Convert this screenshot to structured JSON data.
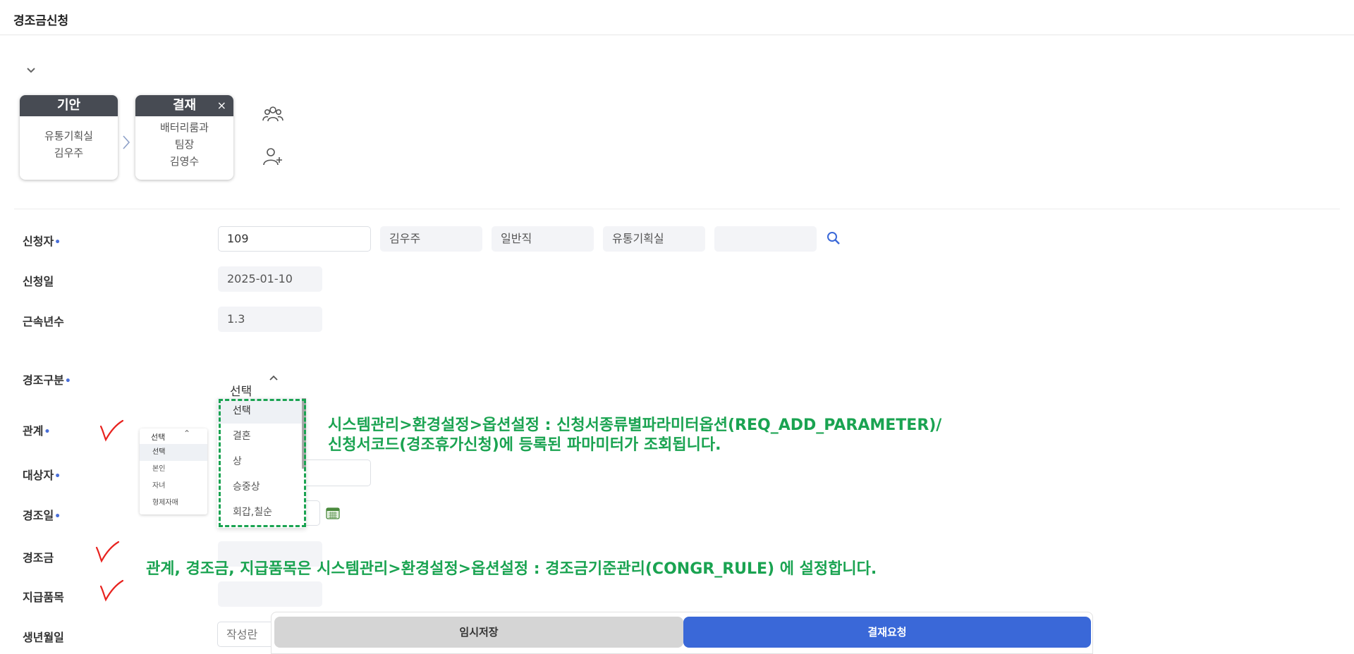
{
  "page": {
    "title": "경조금신청"
  },
  "approval_line": {
    "cards": [
      {
        "head": "기안",
        "lines": [
          "유통기획실",
          "김우주"
        ],
        "closable": false
      },
      {
        "head": "결재",
        "lines": [
          "배터리룸과",
          "팀장",
          "김영수"
        ],
        "closable": true,
        "close_glyph": "×"
      }
    ],
    "icons": [
      "group-icon",
      "add-user-icon"
    ]
  },
  "form": {
    "applicant": {
      "label": "신청자",
      "emp_no": "109",
      "name": "김우주",
      "job_type": "일반직",
      "dept": "유통기획실",
      "extra": ""
    },
    "apply_date": {
      "label": "신청일",
      "value": "2025-01-10"
    },
    "years_of_service": {
      "label": "근속년수",
      "value": "1.3"
    },
    "event_type": {
      "label": "경조구분",
      "selected": "선택",
      "options": [
        "선택",
        "결혼",
        "상",
        "승중상",
        "회갑,칠순"
      ]
    },
    "relation": {
      "label": "관계",
      "popup_title": "선택",
      "options": [
        "선택",
        "본인",
        "자녀",
        "형제자매"
      ]
    },
    "target": {
      "label": "대상자",
      "value": ""
    },
    "event_date": {
      "label": "경조일",
      "value": ""
    },
    "amount": {
      "label": "경조금",
      "value": ""
    },
    "gift": {
      "label": "지급품목",
      "value": ""
    },
    "birth_date": {
      "label": "생년월일",
      "placeholder": "작성란"
    }
  },
  "annotations": {
    "note1_line1": "시스템관리>환경설정>옵션설정 : 신청서종류별파라미터옵션(REQ_ADD_PARAMETER)/",
    "note1_line2": "신청서코드(경조휴가신청)에 등록된 파마미터가 조회됩니다.",
    "note2": "관계, 경조금, 지급품목은 시스템관리>환경설정>옵션설정 : 경조금기준관리(CONGR_RULE) 에 설정합니다.",
    "color": "#1aa351",
    "mark_color": "#e8231f"
  },
  "buttons": {
    "save": "임시저장",
    "submit": "결재요청"
  }
}
